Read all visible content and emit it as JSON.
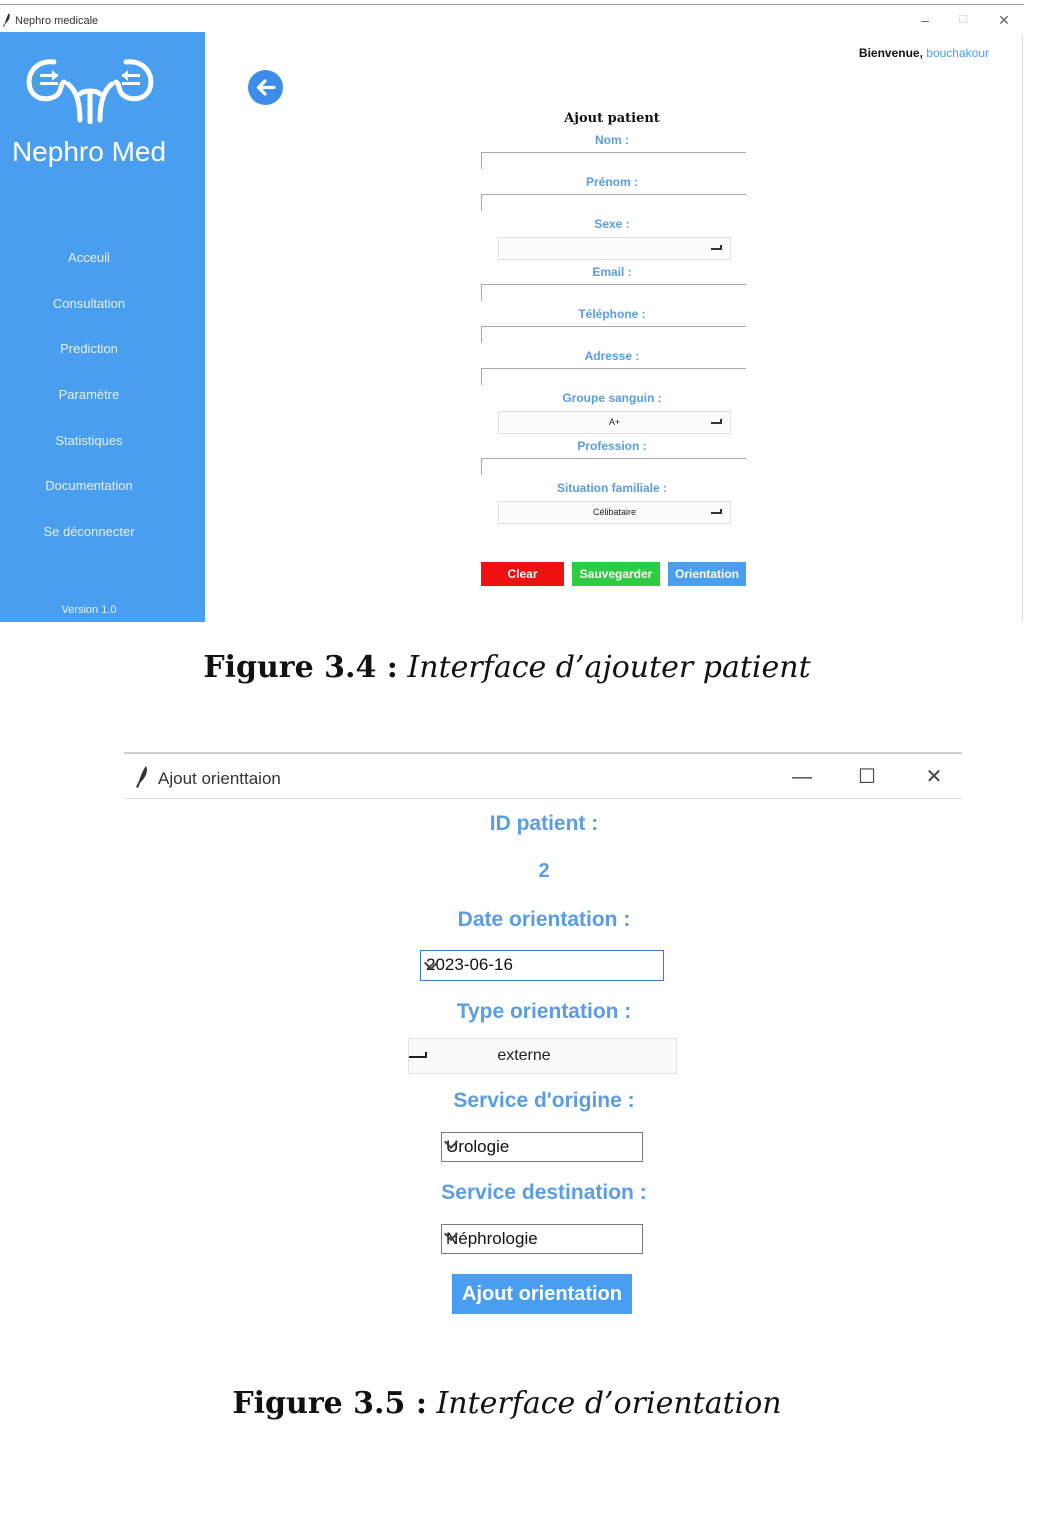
{
  "window1": {
    "title": "Nephro medicale",
    "controls": {
      "minimize": "–",
      "maximize": "☐",
      "close": "✕"
    },
    "brand": "Nephro Med",
    "nav": [
      "Acceuil",
      "Consultation",
      "Prediction",
      "Paramètre",
      "Statistiques",
      "Documentation",
      "Se déconnecter"
    ],
    "version": "Version 1.0",
    "welcome_label": "Bienvenue,",
    "welcome_user": "bouchakour",
    "form": {
      "title": "Ajout patient",
      "labels": {
        "nom": "Nom :",
        "prenom": "Prénom :",
        "sexe": "Sexe :",
        "email": "Email :",
        "telephone": "Téléphone :",
        "adresse": "Adresse :",
        "groupe": "Groupe sanguin :",
        "profession": "Profession :",
        "situation": "Situation familiale :"
      },
      "values": {
        "sexe": "",
        "groupe": "A+",
        "situation": "Célibataire"
      },
      "buttons": {
        "clear": "Clear",
        "save": "Sauvegarder",
        "orientation": "Orientation"
      }
    },
    "colors": {
      "sidebar": "#4a9ef0",
      "accent": "#5b9ce3",
      "clear": "#ee1111",
      "save": "#2ecc40",
      "orientation": "#4a9ef0"
    }
  },
  "caption1": {
    "number": "Figure 3.4 :",
    "text": "Interface d’ajouter patient"
  },
  "window2": {
    "title": "Ajout orienttaion",
    "controls": {
      "minimize": "—",
      "maximize": "☐",
      "close": "✕"
    },
    "labels": {
      "id": "ID patient :",
      "date": "Date orientation :",
      "type": "Type orientation :",
      "origin": "Service d'origine :",
      "dest": "Service destination :"
    },
    "values": {
      "id": "2",
      "date": "2023-06-16",
      "type": "externe",
      "origin": "Urologie",
      "dest": "Néphrologie"
    },
    "submit": "Ajout orientation",
    "icons": [
      "feather-icon",
      "chevron-down-icon"
    ]
  },
  "caption2": {
    "number": "Figure 3.5 :",
    "text": "Interface d’orientation"
  }
}
